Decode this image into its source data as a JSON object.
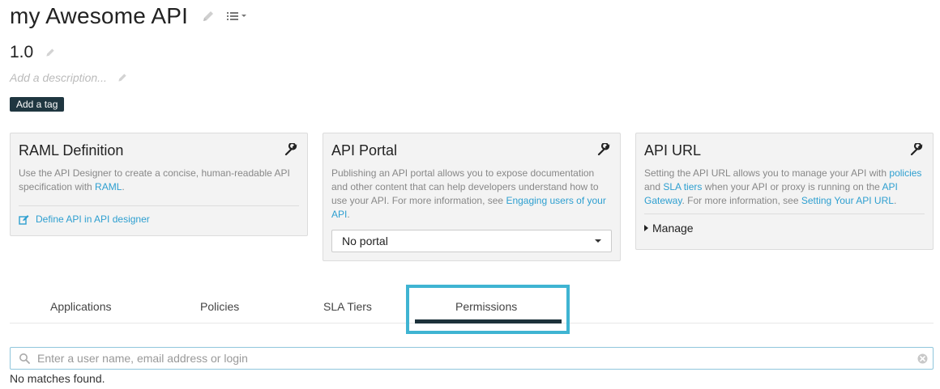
{
  "header": {
    "title": "my Awesome API",
    "version": "1.0",
    "description_placeholder": "Add a description...",
    "add_tag_label": "Add a tag"
  },
  "cards": {
    "raml": {
      "title": "RAML Definition",
      "text": "Use the API Designer to create a concise, human-readable API specification with ",
      "text_link": "RAML",
      "text_end": ".",
      "action_label": "Define API in API designer"
    },
    "portal": {
      "title": "API Portal",
      "text": "Publishing an API portal allows you to expose documentation and other content that can help developers understand how to use your API. For more information, see ",
      "text_link": "Engaging users of your API",
      "text_end": ".",
      "select_value": "No portal"
    },
    "url": {
      "title": "API URL",
      "text_1": "Setting the API URL allows you to manage your API with ",
      "link_policies": "policies",
      "text_2": " and ",
      "link_sla": "SLA tiers",
      "text_3": " when your API or proxy is running on the ",
      "link_gateway": "API Gateway",
      "text_4": ". For more information, see ",
      "link_setting": "Setting Your API URL",
      "text_5": ".",
      "manage_label": "Manage"
    }
  },
  "tabs": {
    "applications": "Applications",
    "policies": "Policies",
    "sla_tiers": "SLA Tiers",
    "permissions": "Permissions",
    "active": "Permissions"
  },
  "search": {
    "placeholder": "Enter a user name, email address or login",
    "value": ""
  },
  "results": {
    "empty_message": "No matches found."
  },
  "colors": {
    "accent_link": "#2e9fd0",
    "highlight_border": "#3fb4d2",
    "tag_button_bg": "#1f3640"
  },
  "icons": [
    "pencil-icon",
    "list-menu-icon",
    "wrench-icon",
    "edit-icon",
    "search-icon",
    "clear-icon"
  ]
}
